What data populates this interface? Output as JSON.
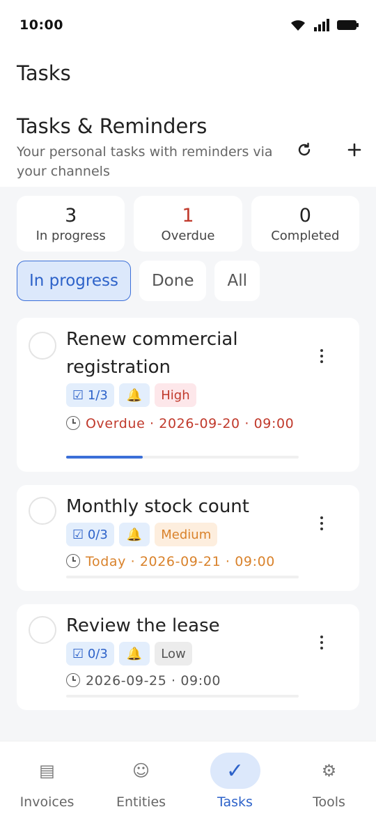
{
  "status_bar": {
    "time": "10:00"
  },
  "app": {
    "title": "Tasks"
  },
  "section": {
    "title": "Tasks & Reminders",
    "subtitle": "Your personal tasks with reminders via your channels",
    "refresh_icon": "refresh-icon",
    "add_icon": "plus-icon"
  },
  "stats": [
    {
      "value": "3",
      "label": "In progress"
    },
    {
      "value": "1",
      "label": "Overdue",
      "color": "#c0392b"
    },
    {
      "value": "0",
      "label": "Completed"
    }
  ],
  "filters": [
    {
      "label": "In progress",
      "selected": true
    },
    {
      "label": "Done"
    },
    {
      "label": "All"
    }
  ],
  "tasks": [
    {
      "title": "Renew commercial registration",
      "subtasks": "☑ 1/3",
      "reminder_icon": "🔔",
      "priority": "High",
      "due": "Overdue · 2026-09-20 · 09:00",
      "progress": 0.33
    },
    {
      "title": "Monthly stock count",
      "subtasks": "☑ 0/3",
      "reminder_icon": "🔔",
      "priority": "Medium",
      "due": "Today · 2026-09-21 · 09:00",
      "progress": 0
    },
    {
      "title": "Review the lease",
      "subtasks": "☑ 0/3",
      "reminder_icon": "🔔",
      "priority": "Low",
      "due": "2026-09-25 · 09:00",
      "progress": 0
    }
  ],
  "nav": [
    {
      "label": "Invoices",
      "icon": "▤"
    },
    {
      "label": "Entities",
      "icon": "☺"
    },
    {
      "label": "Tasks",
      "icon": "✓",
      "active": true
    },
    {
      "label": "Tools",
      "icon": "⚙"
    }
  ],
  "colors": {
    "accent": "#2d62c9",
    "overdue": "#c0392b",
    "medium": "#d9822b"
  }
}
